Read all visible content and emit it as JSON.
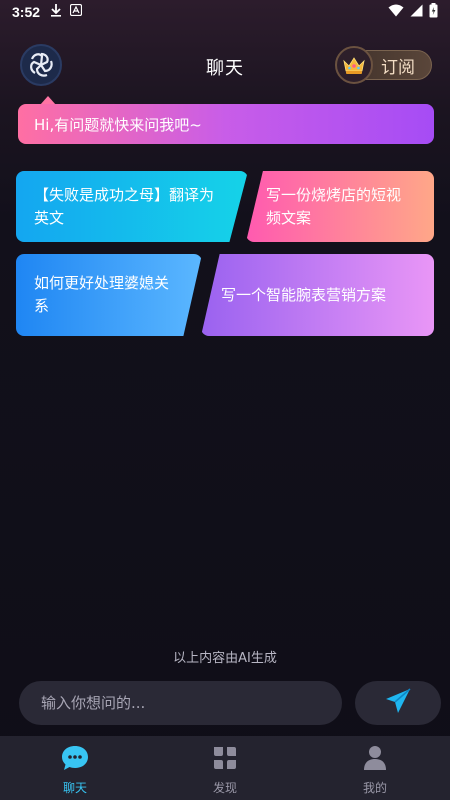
{
  "status_bar": {
    "time": "3:52"
  },
  "header": {
    "title": "聊天",
    "subscribe_label": "订阅"
  },
  "greeting": "Hi,有问题就快来问我吧~",
  "suggestions": [
    {
      "text": "【失败是成功之母】翻译为英文",
      "color_from": "#14a6f0",
      "color_to": "#15d3e8"
    },
    {
      "text": "写一份烧烤店的短视频文案",
      "color_from": "#ff5ab0",
      "color_to": "#ffa788"
    },
    {
      "text": "如何更好处理婆媳关系",
      "color_from": "#1f86f3",
      "color_to": "#5bb7ff"
    },
    {
      "text": "写一个智能腕表营销方案",
      "color_from": "#9a62f0",
      "color_to": "#e996f6"
    }
  ],
  "ai_note": "以上内容由AI生成",
  "input": {
    "placeholder": "输入你想问的..."
  },
  "nav": {
    "items": [
      {
        "label": "聊天",
        "icon": "chat-bubble-icon",
        "active": true
      },
      {
        "label": "发现",
        "icon": "grid-icon",
        "active": false
      },
      {
        "label": "我的",
        "icon": "user-icon",
        "active": false
      }
    ]
  },
  "colors": {
    "accent": "#38c5f3",
    "background": "#0f0e17",
    "nav_background": "#24232f"
  }
}
